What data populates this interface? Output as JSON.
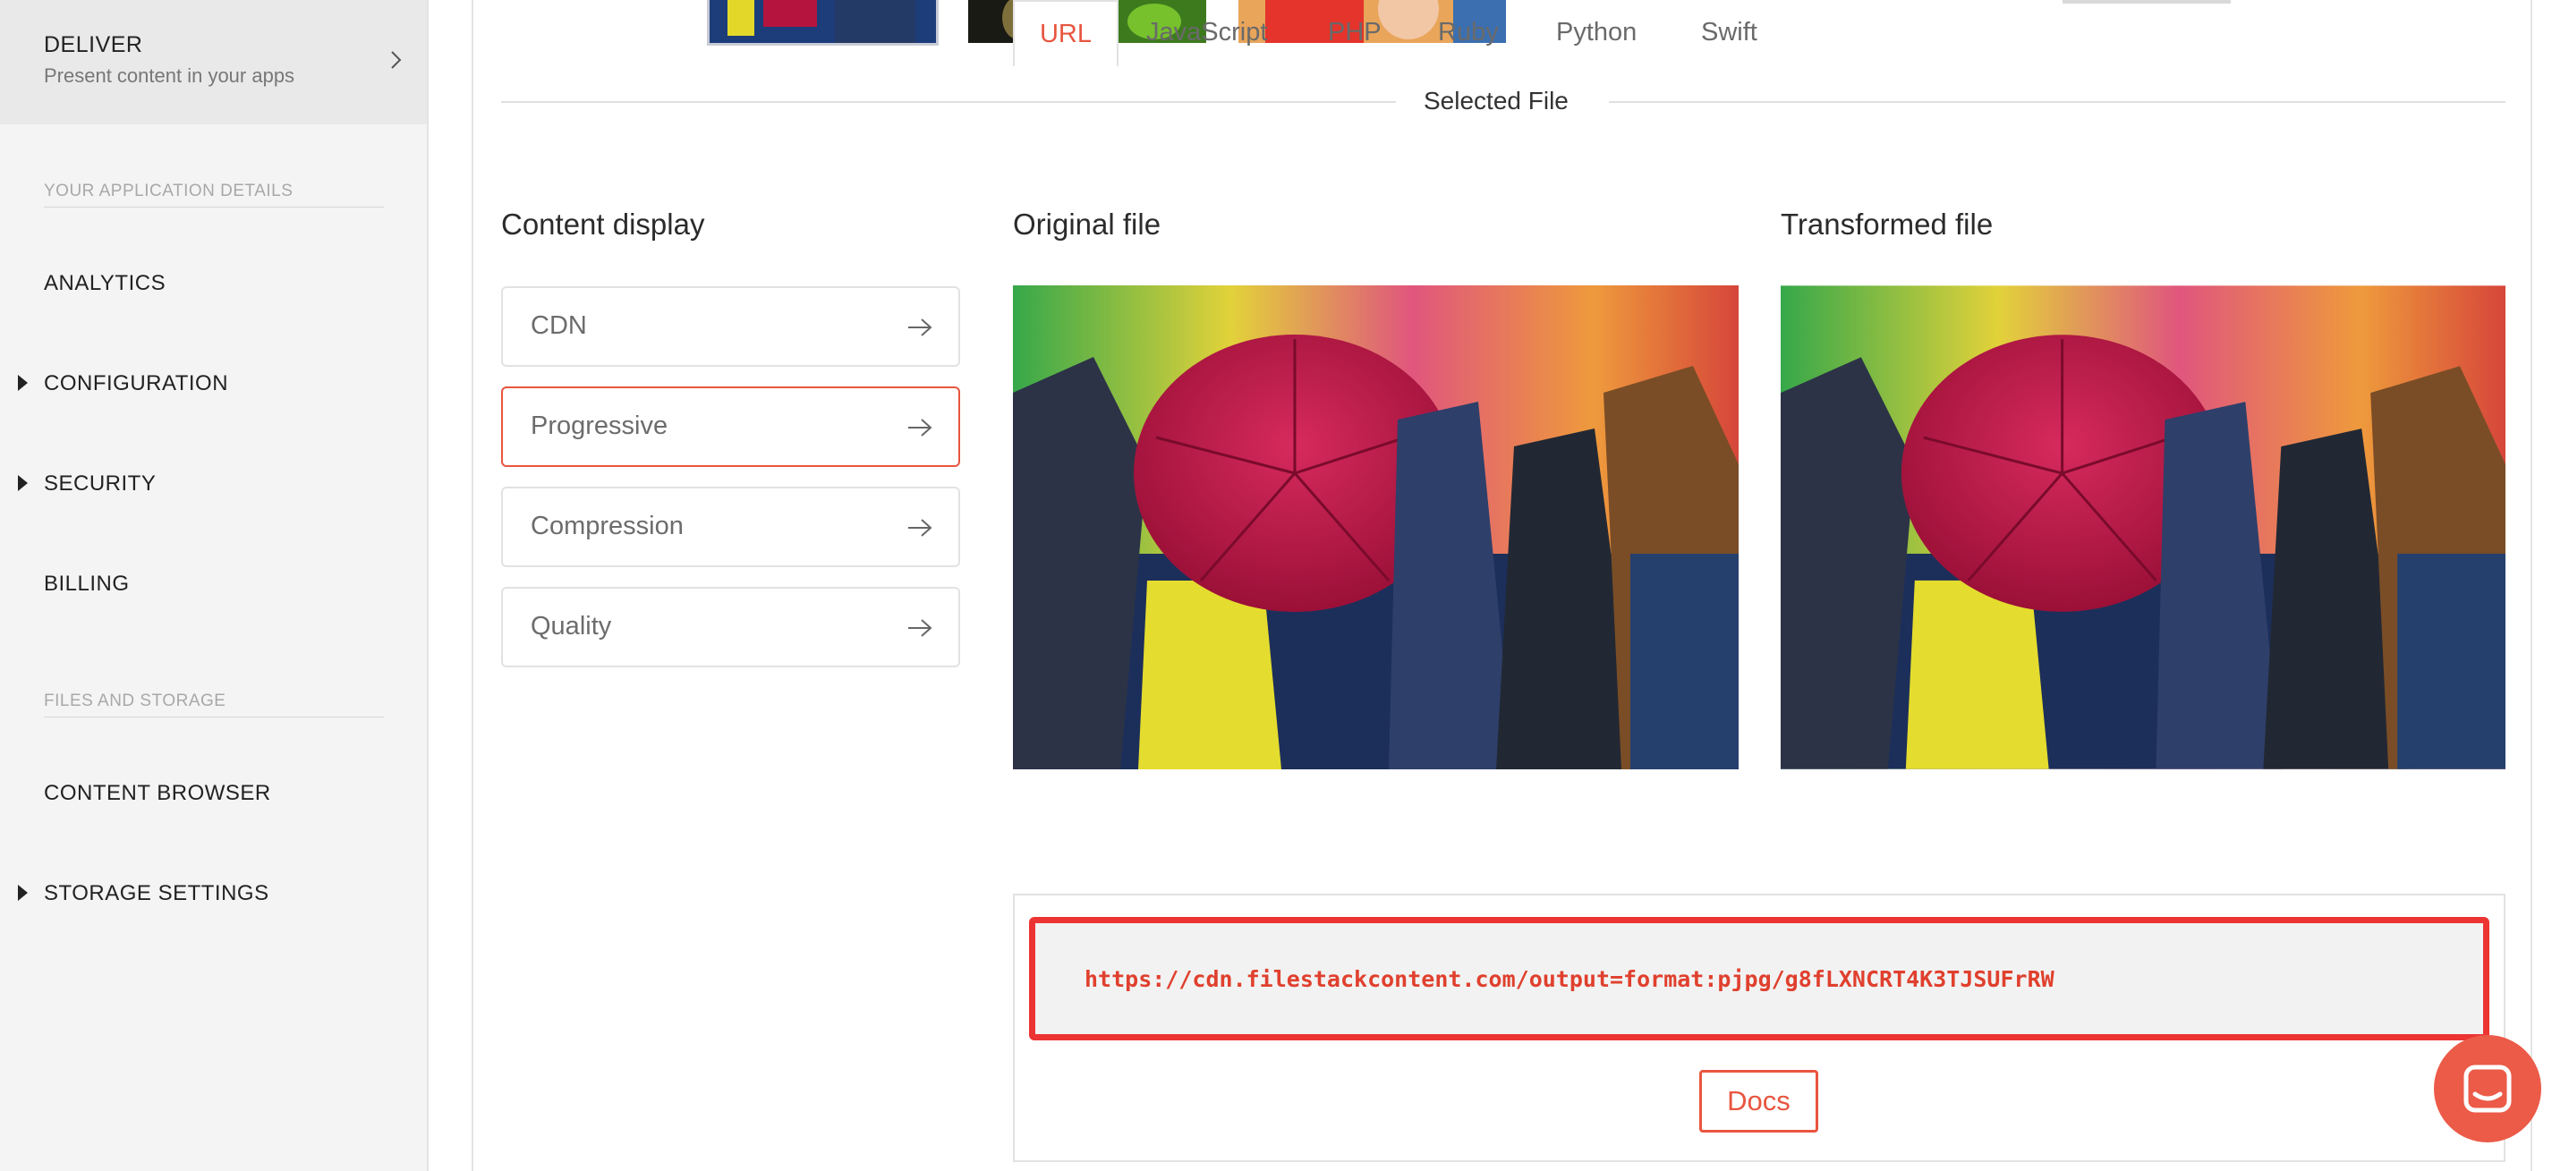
{
  "sidebar": {
    "deliver": {
      "title": "DELIVER",
      "subtitle": "Present content in your apps",
      "icon": "chevron-right-icon"
    },
    "sections": [
      {
        "heading": "YOUR APPLICATION DETAILS"
      },
      {
        "heading": "FILES AND STORAGE"
      }
    ],
    "items": [
      {
        "label": "ANALYTICS",
        "expandable": false
      },
      {
        "label": "CONFIGURATION",
        "expandable": true
      },
      {
        "label": "SECURITY",
        "expandable": true
      },
      {
        "label": "BILLING",
        "expandable": false
      },
      {
        "label": "CONTENT BROWSER",
        "expandable": false
      },
      {
        "label": "STORAGE SETTINGS",
        "expandable": true
      }
    ]
  },
  "main": {
    "selected_file_label": "Selected File",
    "content_display": {
      "title": "Content display",
      "options": [
        {
          "label": "CDN",
          "active": false
        },
        {
          "label": "Progressive",
          "active": true
        },
        {
          "label": "Compression",
          "active": false
        },
        {
          "label": "Quality",
          "active": false
        }
      ]
    },
    "original_title": "Original file",
    "transformed_title": "Transformed file",
    "tabs": [
      {
        "label": "URL",
        "active": true
      },
      {
        "label": "JavaScript",
        "active": false
      },
      {
        "label": "PHP",
        "active": false
      },
      {
        "label": "Ruby",
        "active": false
      },
      {
        "label": "Python",
        "active": false
      },
      {
        "label": "Swift",
        "active": false
      }
    ],
    "code": "https://cdn.filestackcontent.com/output=format:pjpg/g8fLXNCRT4K3TJSUFrRW",
    "docs_label": "Docs"
  },
  "colors": {
    "accent": "#e8553f",
    "highlight_border": "#ec3433",
    "sidebar_bg": "#f4f4f4"
  }
}
